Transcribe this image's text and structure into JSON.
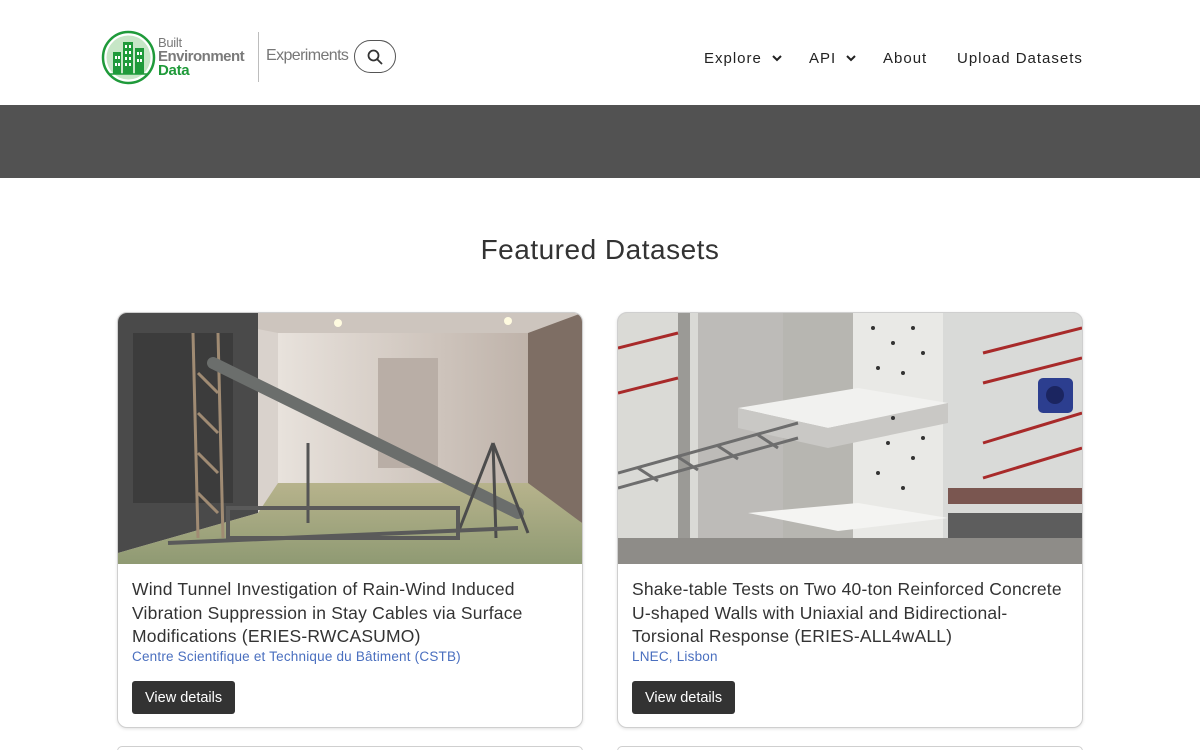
{
  "header": {
    "logo": {
      "line1": "Built",
      "line2": "Environment",
      "line3": "Data"
    },
    "experiments_label": "Experiments",
    "nav": [
      {
        "label": "Explore",
        "has_dropdown": true
      },
      {
        "label": "API",
        "has_dropdown": true
      },
      {
        "label": "About",
        "has_dropdown": false
      },
      {
        "label": "Upload Datasets",
        "has_dropdown": false
      }
    ]
  },
  "section": {
    "title": "Featured Datasets"
  },
  "cards": [
    {
      "title": "Wind Tunnel Investigation of Rain-Wind Induced Vibration Suppression in Stay Cables via Surface Modifications (ERIES-RWCASUMO)",
      "institution": "Centre Scientifique et Technique du Bâtiment (CSTB)",
      "button_label": "View details"
    },
    {
      "title": "Shake-table Tests on Two 40-ton Reinforced Concrete U-shaped Walls with Uniaxial and Bidirectional-Torsional Response (ERIES-ALL4wALL)",
      "institution": "LNEC, Lisbon",
      "button_label": "View details"
    }
  ],
  "colors": {
    "brand_green": "#1f9a3a",
    "banner": "#525252",
    "link": "#4a6fbf",
    "button": "#333333"
  }
}
